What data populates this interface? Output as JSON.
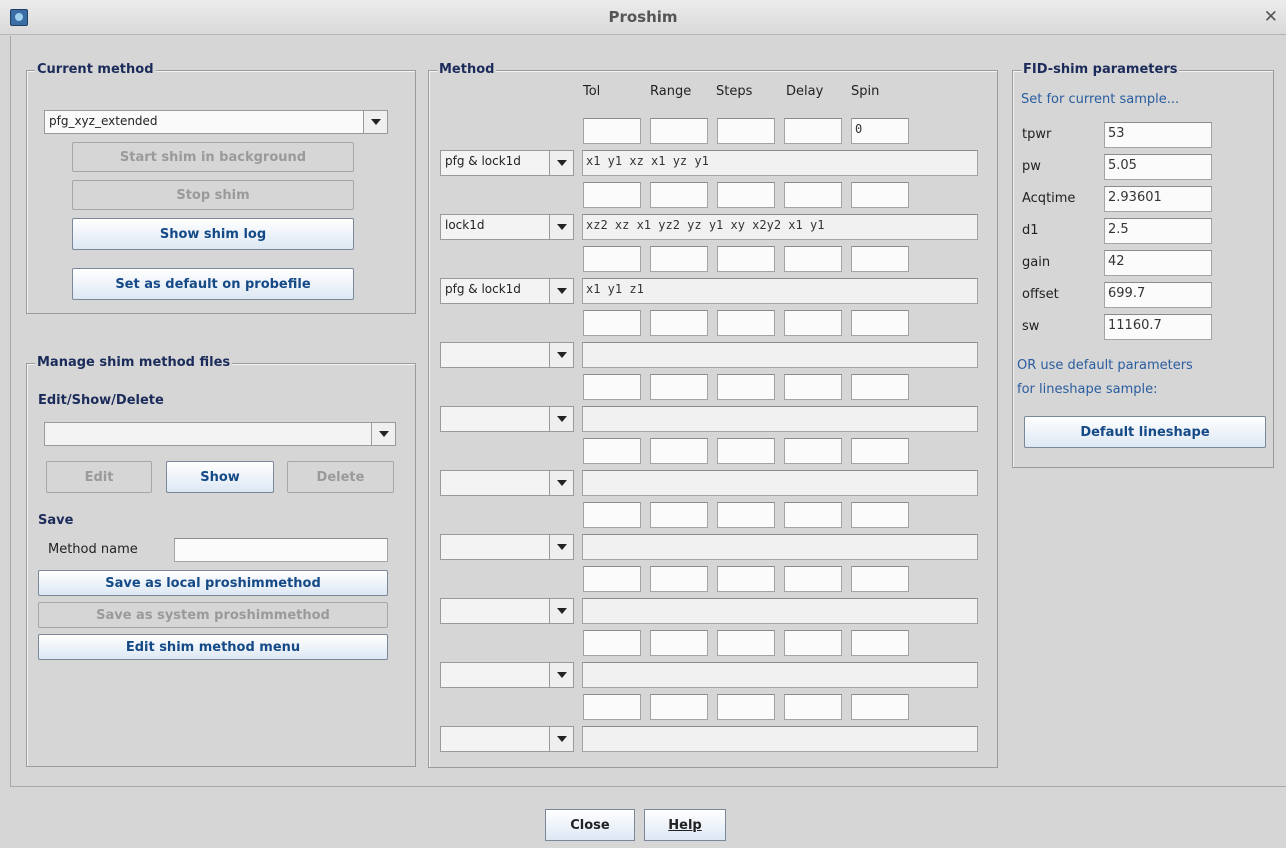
{
  "window": {
    "title": "Proshim"
  },
  "current_method": {
    "title": "Current method",
    "selected": "pfg_xyz_extended",
    "start_label": "Start shim in background",
    "stop_label": "Stop shim",
    "show_log_label": "Show shim log",
    "set_default_label": "Set as default on probefile"
  },
  "manage": {
    "title": "Manage shim method files",
    "edit_heading": "Edit/Show/Delete",
    "selected": "",
    "edit_label": "Edit",
    "show_label": "Show",
    "delete_label": "Delete",
    "save_heading": "Save",
    "method_name_label": "Method name",
    "method_name_value": "",
    "save_local_label": "Save as local proshimmethod",
    "save_system_label": "Save as system proshimmethod",
    "edit_menu_label": "Edit shim method menu"
  },
  "method": {
    "title": "Method",
    "columns": [
      "Tol",
      "Range",
      "Steps",
      "Delay",
      "Spin"
    ],
    "param_rows": [
      [
        "",
        "",
        "",
        "",
        "0"
      ],
      [
        "",
        "",
        "",
        "",
        ""
      ],
      [
        "",
        "",
        "",
        "",
        ""
      ],
      [
        "",
        "",
        "",
        "",
        ""
      ],
      [
        "",
        "",
        "",
        "",
        ""
      ],
      [
        "",
        "",
        "",
        "",
        ""
      ],
      [
        "",
        "",
        "",
        "",
        ""
      ],
      [
        "",
        "",
        "",
        "",
        ""
      ],
      [
        "",
        "",
        "",
        "",
        ""
      ],
      [
        "",
        "",
        "",
        "",
        ""
      ]
    ],
    "shim_rows": [
      {
        "type": "pfg & lock1d",
        "shims": "x1 y1 xz x1 yz y1"
      },
      {
        "type": "lock1d",
        "shims": "xz2 xz x1 yz2 yz y1 xy x2y2 x1 y1"
      },
      {
        "type": "pfg & lock1d",
        "shims": "x1 y1 z1"
      },
      {
        "type": "",
        "shims": ""
      },
      {
        "type": "",
        "shims": ""
      },
      {
        "type": "",
        "shims": ""
      },
      {
        "type": "",
        "shims": ""
      },
      {
        "type": "",
        "shims": ""
      },
      {
        "type": "",
        "shims": ""
      },
      {
        "type": "",
        "shims": ""
      }
    ]
  },
  "fid": {
    "title": "FID-shim parameters",
    "subtitle": "Set for current sample...",
    "params": [
      {
        "name": "tpwr",
        "value": "53"
      },
      {
        "name": "pw",
        "value": "5.05"
      },
      {
        "name": "Acqtime",
        "value": "2.93601"
      },
      {
        "name": "d1",
        "value": "2.5"
      },
      {
        "name": "gain",
        "value": "42"
      },
      {
        "name": "offset",
        "value": "699.7"
      },
      {
        "name": "sw",
        "value": "11160.7"
      }
    ],
    "or_text_1": "OR use default parameters",
    "or_text_2": "for lineshape sample:",
    "default_lineshape_label": "Default lineshape"
  },
  "footer": {
    "close_label": "Close",
    "help_label": "Help"
  }
}
